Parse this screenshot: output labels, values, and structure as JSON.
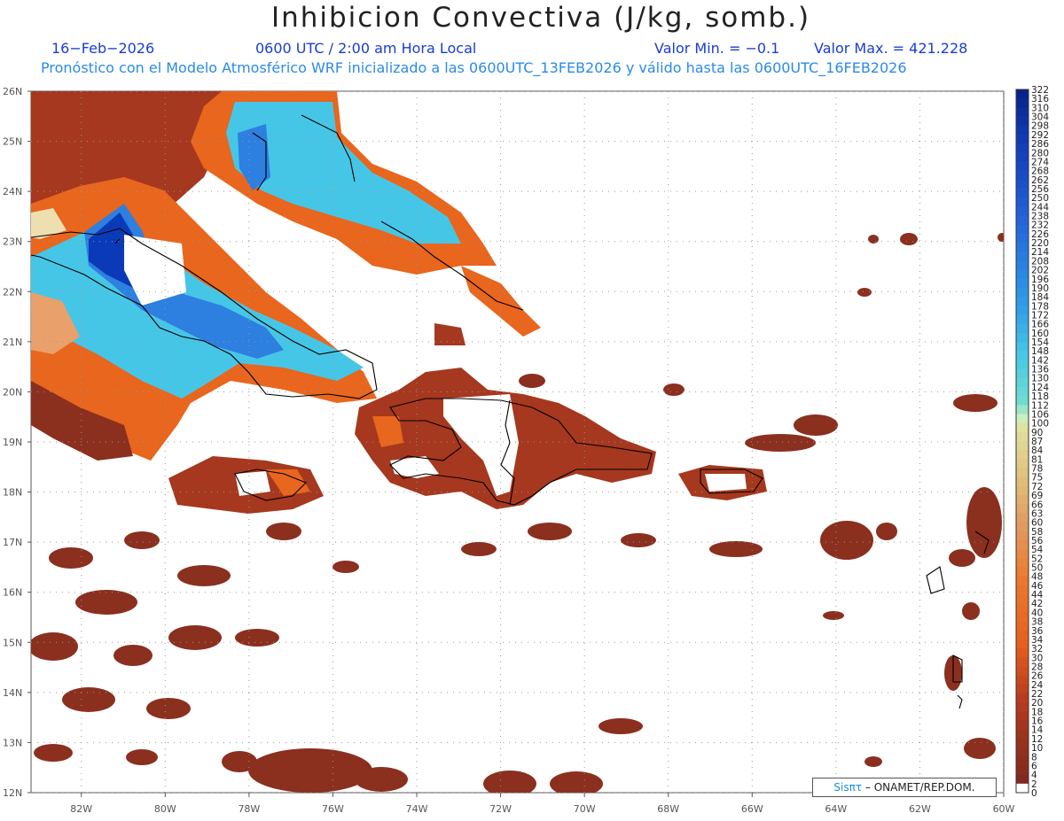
{
  "header": {
    "title": "Inhibicion Convectiva (J/kg, somb.)",
    "date": "16−Feb−2026",
    "time": "0600 UTC / 2:00 am Hora Local",
    "min_label": "Valor Min. = −0.1",
    "max_label": "Valor Max. = 421.228",
    "subtitle": "Pronóstico con el Modelo Atmosférico WRF inicializado a las 0600UTC_13FEB2026 y válido hasta las  0600UTC_16FEB2026"
  },
  "map": {
    "lon_range": [
      -83.2,
      -60
    ],
    "lat_range": [
      12,
      26
    ],
    "lat_ticks": [
      "12N",
      "13N",
      "14N",
      "15N",
      "16N",
      "17N",
      "18N",
      "19N",
      "20N",
      "21N",
      "22N",
      "23N",
      "24N",
      "25N",
      "26N"
    ],
    "lon_ticks": [
      "82W",
      "80W",
      "78W",
      "76W",
      "74W",
      "72W",
      "70W",
      "68W",
      "66W",
      "64W",
      "62W",
      "60W"
    ],
    "grid": true,
    "colors": {
      "dark": "#8b2f1f",
      "brick": "#a5381e",
      "orange": "#e8661e",
      "peach": "#e9a06b",
      "pale": "#eedfb0",
      "cyan": "#46c6e6",
      "blue": "#2d7fe0",
      "navy": "#0a3ab8",
      "coast": "#000000"
    }
  },
  "colorbar": {
    "levels": [
      "322",
      "316",
      "310",
      "304",
      "298",
      "292",
      "286",
      "280",
      "274",
      "268",
      "262",
      "256",
      "250",
      "244",
      "238",
      "232",
      "226",
      "220",
      "214",
      "208",
      "202",
      "196",
      "190",
      "184",
      "178",
      "172",
      "166",
      "160",
      "154",
      "148",
      "142",
      "136",
      "130",
      "124",
      "118",
      "112",
      "106",
      "100",
      "90",
      "87",
      "84",
      "81",
      "78",
      "75",
      "72",
      "69",
      "66",
      "63",
      "60",
      "58",
      "56",
      "54",
      "52",
      "50",
      "48",
      "46",
      "44",
      "42",
      "40",
      "38",
      "36",
      "34",
      "32",
      "30",
      "28",
      "26",
      "24",
      "22",
      "20",
      "18",
      "16",
      "14",
      "12",
      "10",
      "8",
      "6",
      "4",
      "2",
      "0"
    ]
  },
  "credit": {
    "brand": "Sisπτ",
    "org": "– ONAMET/REP.DOM."
  }
}
